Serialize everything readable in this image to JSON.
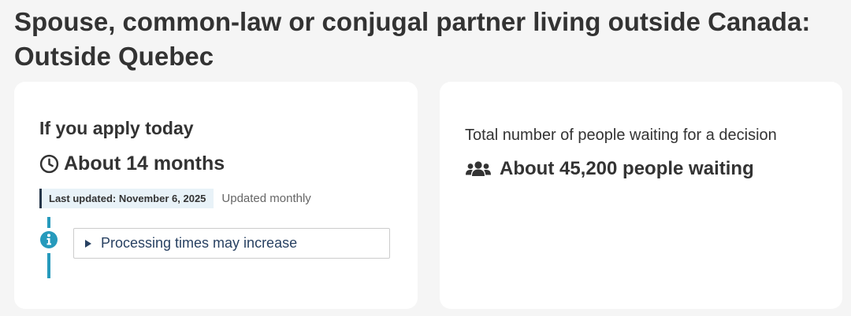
{
  "page": {
    "title_line1": "Spouse, common-law or conjugal partner living outside Canada:",
    "title_line2": "Outside Quebec"
  },
  "apply_card": {
    "heading": "If you apply today",
    "processing_time": "About 14 months",
    "time_icon": "clock-icon",
    "last_updated": "Last updated: November 6, 2025",
    "update_frequency": "Updated monthly",
    "info_icon": "info-icon",
    "notice_label": "Processing times may increase"
  },
  "waiting_card": {
    "heading": "Total number of people waiting for a decision",
    "people_icon": "users-icon",
    "waiting_count": "About 45,200 people waiting"
  },
  "colors": {
    "background": "#f5f5f5",
    "card": "#ffffff",
    "text": "#333333",
    "link": "#284162",
    "accent_bar": "#269abc",
    "badge_bg": "#e8f2f8",
    "badge_border": "#26374a"
  }
}
